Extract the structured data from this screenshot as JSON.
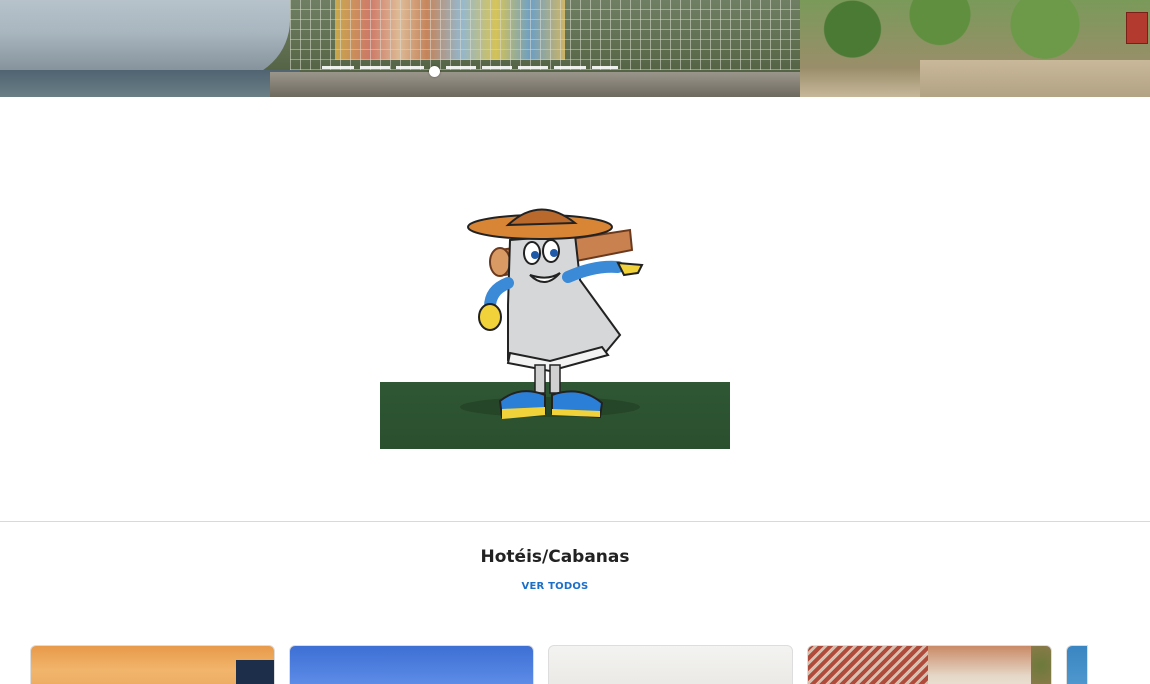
{
  "hero": {
    "slides_count": 8,
    "active_slide": 4
  },
  "mascot": {
    "alt": ""
  },
  "section": {
    "title": "Hotéis/Cabanas",
    "view_all": "VER TODOS"
  },
  "cards": [
    {
      "name": "card-1"
    },
    {
      "name": "card-2"
    },
    {
      "name": "card-3"
    },
    {
      "name": "card-4"
    },
    {
      "name": "card-5"
    }
  ],
  "colors": {
    "accent": "#1a6fc9",
    "title": "#222222",
    "ground": "#2f5734"
  }
}
